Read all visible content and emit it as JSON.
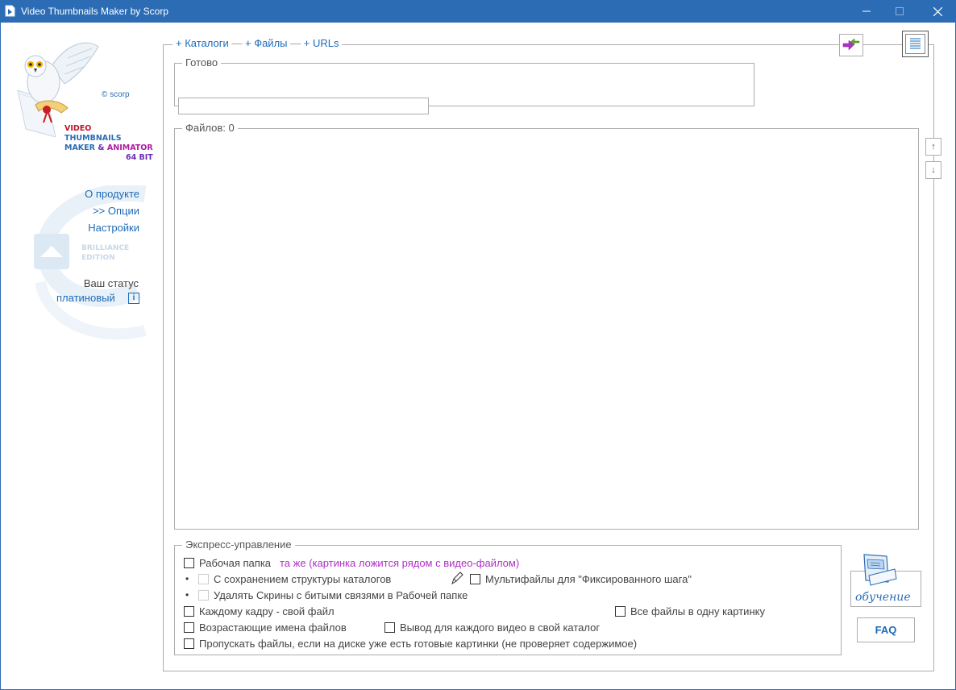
{
  "window": {
    "title": "Video Thumbnails Maker by Scorp",
    "controls": {
      "minimize": "—",
      "maximize": "☐",
      "close": "✕"
    }
  },
  "logo": {
    "copyright": "© scorp",
    "brand_line1": "VIDEO",
    "brand_line2": "THUMBNAILS",
    "brand_line3_a": "MAKER",
    "brand_line3_b": "&",
    "brand_line3_c": "ANIMATOR",
    "brand_line4": "64 BIT"
  },
  "sidebar": {
    "about": "О продукте",
    "options": ">> Опции",
    "settings": "Настройки",
    "edition_line1": "BRILLIANCE",
    "edition_line2": "EDITION",
    "status_label": "Ваш статус",
    "status_value": "платиновый",
    "info_glyph": "i"
  },
  "toolbar": {
    "add_catalogs": "+ Каталоги",
    "sep1": "—",
    "add_files": "+ Файлы",
    "sep2": "—",
    "add_urls": "+ URLs"
  },
  "status": {
    "ready_label": "Готово",
    "files_label": "Файлов: 0"
  },
  "arrows": {
    "up": "↑",
    "down": "↓"
  },
  "express": {
    "label": "Экспресс-управление",
    "work_folder": "Рабочая папка",
    "work_folder_value": "та же (картинка ложится рядом с видео-файлом)",
    "keep_structure": "С сохранением структуры каталогов",
    "multifiles": "Мультифайлы для \"Фиксированного шага\"",
    "delete_broken": "Удалять Скрины с битыми связями в Рабочей папке",
    "each_frame": "Каждому кадру - свой файл",
    "all_in_one": "Все файлы в одну картинку",
    "ascending_names": "Возрастающие имена файлов",
    "own_catalog": "Вывод для каждого видео в свой каталог",
    "skip_existing": "Пропускать файлы, если на диске уже есть готовые картинки (не проверяет содержимое)",
    "bullet": "•"
  },
  "help": {
    "learning": "обучение",
    "faq": "FAQ"
  }
}
